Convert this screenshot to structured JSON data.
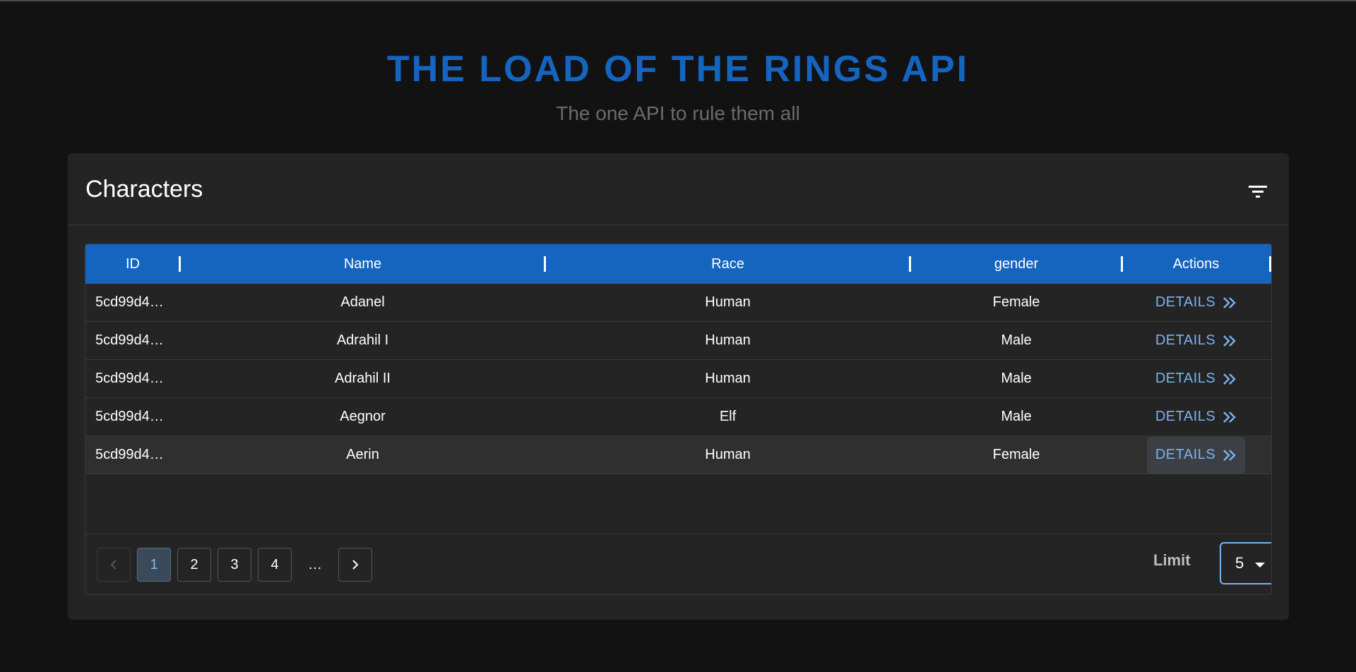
{
  "header": {
    "title": "THE LOAD OF THE RINGS API",
    "subtitle": "The one API to rule them all"
  },
  "card": {
    "title": "Characters",
    "filter_icon": "filter-icon"
  },
  "table": {
    "columns": [
      "ID",
      "Name",
      "Race",
      "gender",
      "Actions"
    ],
    "rows": [
      {
        "id": "5cd99d4…",
        "name": "Adanel",
        "race": "Human",
        "gender": "Female",
        "action": "DETAILS"
      },
      {
        "id": "5cd99d4…",
        "name": "Adrahil I",
        "race": "Human",
        "gender": "Male",
        "action": "DETAILS"
      },
      {
        "id": "5cd99d4…",
        "name": "Adrahil II",
        "race": "Human",
        "gender": "Male",
        "action": "DETAILS"
      },
      {
        "id": "5cd99d4…",
        "name": "Aegnor",
        "race": "Elf",
        "gender": "Male",
        "action": "DETAILS"
      },
      {
        "id": "5cd99d4…",
        "name": "Aerin",
        "race": "Human",
        "gender": "Female",
        "action": "DETAILS"
      }
    ]
  },
  "pagination": {
    "pages": [
      "1",
      "2",
      "3",
      "4"
    ],
    "current": "1",
    "ellipsis": "…",
    "limit_label": "Limit",
    "limit_value": "5"
  },
  "colors": {
    "accent": "#1565c0",
    "link": "#7ab3f0",
    "background": "#121212",
    "surface": "#242424"
  }
}
